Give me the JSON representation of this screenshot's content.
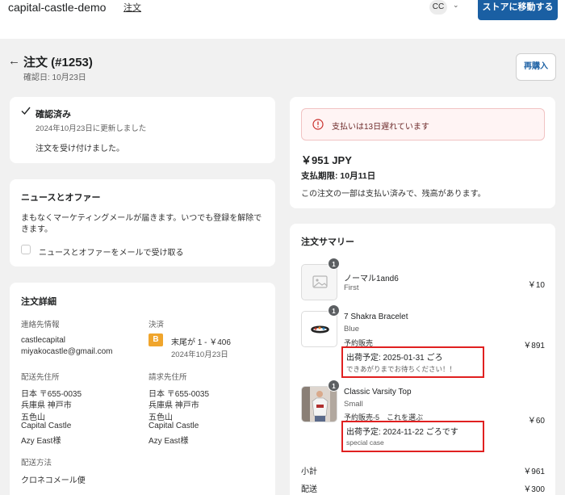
{
  "header": {
    "store_name": "capital-castle-demo",
    "nav_link": "注文",
    "avatar_initials": "CC",
    "store_button": "ストアに移動する"
  },
  "page": {
    "title": "注文 (#1253)",
    "subtitle": "確認日: 10月23日",
    "reorder_button": "再購入"
  },
  "status_card": {
    "title": "確認済み",
    "updated": "2024年10月23日に更新しました",
    "message": "注文を受け付けました。"
  },
  "news_card": {
    "title": "ニュースとオファー",
    "description": "まもなくマーケティングメールが届きます。いつでも登録を解除できます。",
    "checkbox_label": "ニュースとオファーをメールで受け取る"
  },
  "details_card": {
    "title": "注文詳細",
    "contact_label": "連絡先情報",
    "contact_name": "castlecapital",
    "contact_email": "miyakocastle@gmail.com",
    "payment_label": "決済",
    "payment_badge": "B",
    "payment_text": "末尾が 1 - ￥406",
    "payment_date": "2024年10月23日",
    "shipping_label": "配送先住所",
    "shipping_lines": [
      "日本 〒655-0035",
      "兵庫県 神戸市",
      "五色山",
      "Capital Castle",
      "Azy East様"
    ],
    "billing_label": "請求先住所",
    "billing_lines": [
      "日本 〒655-0035",
      "兵庫県 神戸市",
      "五色山",
      "Capital Castle",
      "Azy East様"
    ],
    "method_label": "配送方法",
    "method_value": "クロネコメール便"
  },
  "payment_card": {
    "alert": "支払いは13日遅れています",
    "amount": "￥951 JPY",
    "due": "支払期限: 10月11日",
    "note": "この注文の一部は支払い済みで、残高があります。"
  },
  "summary_card": {
    "title": "注文サマリー",
    "items": [
      {
        "qty": "1",
        "name": "ノーマル1and6",
        "variant": "First",
        "price": "￥10"
      },
      {
        "qty": "1",
        "name": "7 Shakra Bracelet",
        "variant": "Blue",
        "extra": "予約販売",
        "price": "￥891",
        "ship_label": "出荷予定: 2025-01-31 ごろ",
        "ship_note": "できあがりまでお待ちください！！"
      },
      {
        "qty": "1",
        "name": "Classic Varsity Top",
        "variant": "Small",
        "extra": "予約販売-5　これを選ぶ",
        "price": "￥60",
        "ship_label": "出荷予定: 2024-11-22 ごろです",
        "ship_note": "special case"
      }
    ],
    "subtotal_label": "小計",
    "subtotal_value": "￥961",
    "shipping_label": "配送",
    "shipping_value": "￥300"
  },
  "colors": {
    "primary": "#1a5fa3",
    "highlight_border": "#e02020",
    "payment_badge": "#f0a52c"
  }
}
